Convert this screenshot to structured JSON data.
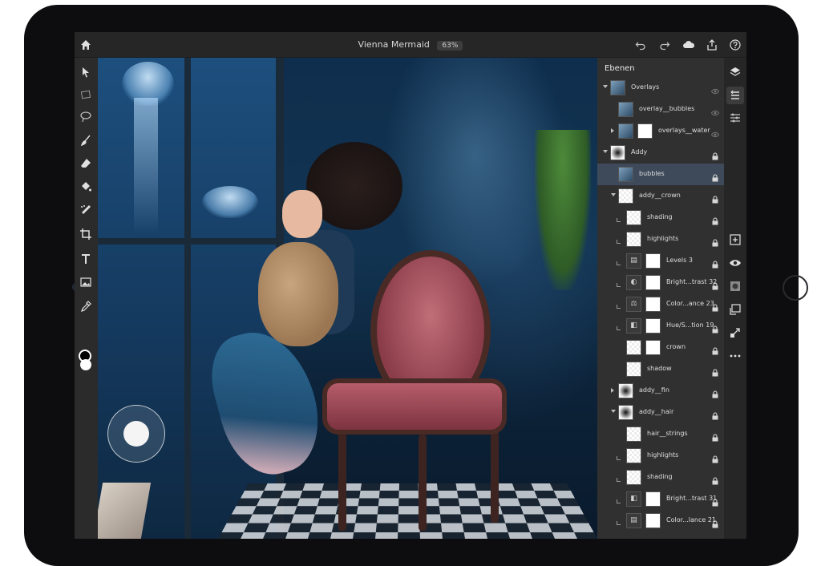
{
  "document": {
    "title": "Vienna Mermaid",
    "zoom": "63%"
  },
  "topbar_icons": [
    "home-icon",
    "undo-icon",
    "redo-icon",
    "cloud-icon",
    "share-icon",
    "help-icon"
  ],
  "tools": [
    "move-tool-icon",
    "transform-tool-icon",
    "lasso-tool-icon",
    "brush-tool-icon",
    "eraser-tool-icon",
    "fill-tool-icon",
    "healing-tool-icon",
    "crop-tool-icon",
    "type-tool-icon",
    "place-image-icon",
    "eyedropper-tool-icon"
  ],
  "colors": {
    "foreground": "#000000",
    "background": "#ffffff",
    "selection": "#3e4a5a"
  },
  "layers_panel": {
    "title": "Ebenen",
    "layers": [
      {
        "name": "Overlays",
        "indent": 0,
        "expander": "open",
        "thumbs": [
          "photo"
        ],
        "icon": "eye-icon",
        "selected": false,
        "clip": false
      },
      {
        "name": "overlay__bubbles",
        "indent": 1,
        "expander": "",
        "thumbs": [
          "photo"
        ],
        "icon": "eye-icon",
        "selected": false,
        "clip": false
      },
      {
        "name": "overlays__water",
        "indent": 1,
        "expander": "closed",
        "thumbs": [
          "photo",
          "white"
        ],
        "icon": "eye-icon",
        "selected": false,
        "clip": false
      },
      {
        "name": "Addy",
        "indent": 0,
        "expander": "open",
        "thumbs": [
          "dark"
        ],
        "icon": "lock-icon",
        "selected": false,
        "clip": false
      },
      {
        "name": "bubbles",
        "indent": 1,
        "expander": "",
        "thumbs": [
          "photo"
        ],
        "icon": "lock-icon",
        "selected": true,
        "clip": false
      },
      {
        "name": "addy__crown",
        "indent": 1,
        "expander": "open",
        "thumbs": [
          "checker"
        ],
        "icon": "lock-icon",
        "selected": false,
        "clip": false
      },
      {
        "name": "shading",
        "indent": 2,
        "expander": "",
        "thumbs": [
          "checker"
        ],
        "icon": "lock-icon",
        "selected": false,
        "clip": true
      },
      {
        "name": "highlights",
        "indent": 2,
        "expander": "",
        "thumbs": [
          "checker"
        ],
        "icon": "lock-icon",
        "selected": false,
        "clip": true
      },
      {
        "name": "Levels 3",
        "indent": 2,
        "expander": "",
        "thumbs": [
          "adj",
          "white"
        ],
        "icon": "lock-icon",
        "selected": false,
        "clip": true
      },
      {
        "name": "Bright...trast 32",
        "indent": 2,
        "expander": "",
        "thumbs": [
          "adj",
          "white"
        ],
        "icon": "lock-icon",
        "selected": false,
        "clip": true
      },
      {
        "name": "Color...ance 23",
        "indent": 2,
        "expander": "",
        "thumbs": [
          "adj",
          "white"
        ],
        "icon": "lock-icon",
        "selected": false,
        "clip": true
      },
      {
        "name": "Hue/S...tion 19",
        "indent": 2,
        "expander": "",
        "thumbs": [
          "adj",
          "white"
        ],
        "icon": "lock-icon",
        "selected": false,
        "clip": true
      },
      {
        "name": "crown",
        "indent": 2,
        "expander": "",
        "thumbs": [
          "checker",
          "white"
        ],
        "icon": "lock-icon",
        "selected": false,
        "clip": false
      },
      {
        "name": "shadow",
        "indent": 2,
        "expander": "",
        "thumbs": [
          "checker"
        ],
        "icon": "lock-icon",
        "selected": false,
        "clip": false
      },
      {
        "name": "addy__fin",
        "indent": 1,
        "expander": "closed",
        "thumbs": [
          "dark"
        ],
        "icon": "lock-icon",
        "selected": false,
        "clip": false
      },
      {
        "name": "addy__hair",
        "indent": 1,
        "expander": "open",
        "thumbs": [
          "dark"
        ],
        "icon": "lock-icon",
        "selected": false,
        "clip": false
      },
      {
        "name": "hair__strings",
        "indent": 2,
        "expander": "",
        "thumbs": [
          "checker"
        ],
        "icon": "lock-icon",
        "selected": false,
        "clip": false
      },
      {
        "name": "highlights",
        "indent": 2,
        "expander": "",
        "thumbs": [
          "checker"
        ],
        "icon": "lock-icon",
        "selected": false,
        "clip": true
      },
      {
        "name": "shading",
        "indent": 2,
        "expander": "",
        "thumbs": [
          "checker"
        ],
        "icon": "lock-icon",
        "selected": false,
        "clip": true
      },
      {
        "name": "Bright...trast 31",
        "indent": 2,
        "expander": "",
        "thumbs": [
          "adj",
          "white"
        ],
        "icon": "lock-icon",
        "selected": false,
        "clip": true
      },
      {
        "name": "Color...lance 21",
        "indent": 2,
        "expander": "",
        "thumbs": [
          "adj",
          "white"
        ],
        "icon": "lock-icon",
        "selected": false,
        "clip": true
      }
    ]
  },
  "rightbar_icons": [
    "layers-icon",
    "layer-properties-icon",
    "adjustments-icon",
    "add-layer-icon",
    "visibility-icon",
    "mask-icon",
    "clip-icon",
    "fx-icon",
    "more-icon"
  ]
}
